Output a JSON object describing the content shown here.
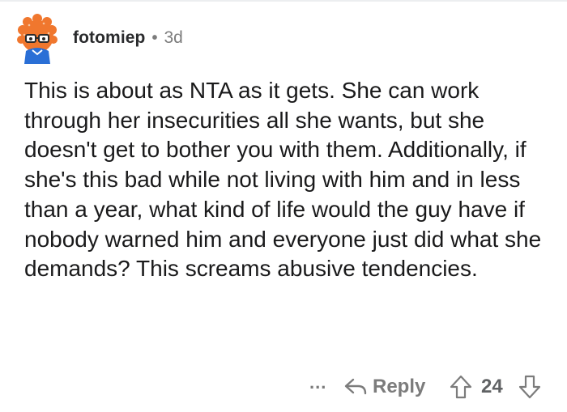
{
  "comment": {
    "author": "fotomiep",
    "separator": "•",
    "age": "3d",
    "body": "This is about as NTA as it gets. She can work through her insecurities all she wants, but she doesn't get to bother you with them. Additionally, if she's this bad while not living with him and in less than a year, what kind of life would the guy have if nobody warned him and everyone just did what she demands? This screams abusive tendencies."
  },
  "actions": {
    "more": "...",
    "reply_label": "Reply",
    "score": "24"
  },
  "icons": {
    "avatar": "snoo-avatar-icon",
    "reply": "reply-arrow-icon",
    "upvote": "upvote-arrow-icon",
    "downvote": "downvote-arrow-icon"
  },
  "colors": {
    "text": "#1a1a1b",
    "meta": "#7c7c7c",
    "avatar_orange": "#f0772e",
    "avatar_blue": "#2a6fd6"
  }
}
